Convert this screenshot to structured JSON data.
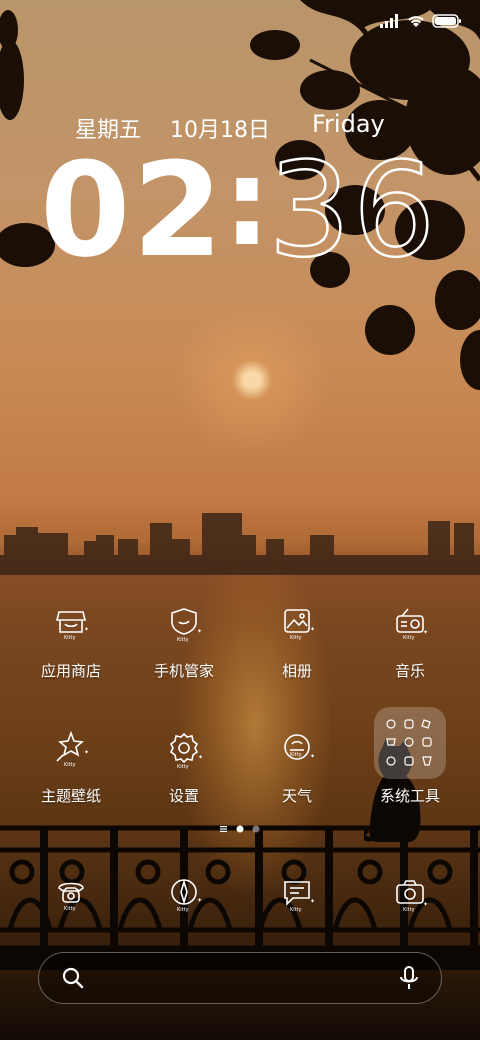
{
  "status_bar": {
    "signal_icon": "signal-icon",
    "wifi_icon": "wifi-icon",
    "battery_icon": "battery-icon"
  },
  "lockscreen": {
    "weekday_cn": "星期五",
    "date_cn": "10月18日",
    "weekday_en": "Friday",
    "clock_hours": "02",
    "clock_colon": ":",
    "clock_minutes": "36"
  },
  "apps": [
    {
      "label": "应用商店",
      "icon": "store-icon"
    },
    {
      "label": "手机管家",
      "icon": "shield-icon"
    },
    {
      "label": "相册",
      "icon": "gallery-icon"
    },
    {
      "label": "音乐",
      "icon": "radio-icon"
    },
    {
      "label": "主题壁纸",
      "icon": "theme-brush-icon"
    },
    {
      "label": "设置",
      "icon": "gear-icon"
    },
    {
      "label": "天气",
      "icon": "weather-icon"
    },
    {
      "label": "系统工具",
      "icon": "folder-icon"
    }
  ],
  "icon_badge_text": "Kitty",
  "page_indicator": {
    "pages": 3,
    "current": 2
  },
  "dock": [
    {
      "icon": "phone-icon"
    },
    {
      "icon": "browser-icon"
    },
    {
      "icon": "messages-icon"
    },
    {
      "icon": "camera-icon"
    }
  ],
  "search": {
    "search_icon": "search-icon",
    "mic_icon": "mic-icon"
  }
}
